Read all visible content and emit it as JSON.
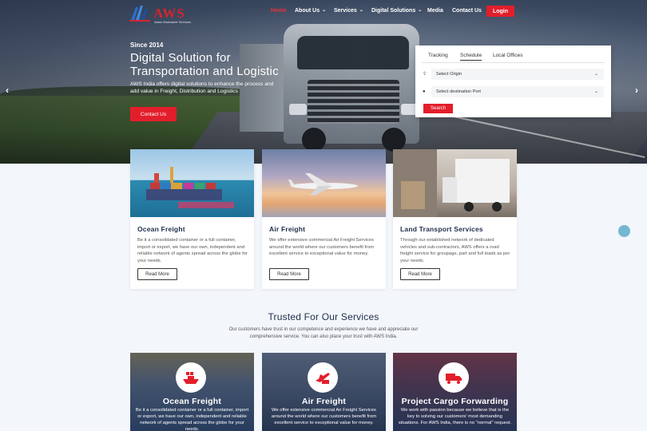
{
  "brand": {
    "logo_text": "AWS",
    "logo_tagline": "Asian Worldwide Services"
  },
  "nav": {
    "items": [
      {
        "label": "Home",
        "has_dropdown": false,
        "active": true
      },
      {
        "label": "About Us",
        "has_dropdown": true
      },
      {
        "label": "Services",
        "has_dropdown": true
      },
      {
        "label": "Digital Solutions",
        "has_dropdown": true
      },
      {
        "label": "Media",
        "has_dropdown": false
      },
      {
        "label": "Contact Us",
        "has_dropdown": false
      }
    ],
    "login_label": "Login"
  },
  "hero": {
    "since": "Since 2014",
    "title_line1": "Digital Solution for",
    "title_line2": "Transportation and Logistic",
    "description": "AWS India offers digital solutions to enhance the process and add value in Freight, Distribution and Logistics",
    "cta_label": "Contact Us",
    "prev_arrow": "‹",
    "next_arrow": "›"
  },
  "tracking_panel": {
    "tabs": [
      {
        "label": "Tracking",
        "active": false
      },
      {
        "label": "Schedule",
        "active": true
      },
      {
        "label": "Local Offices",
        "active": false
      }
    ],
    "origin_placeholder": "Select Origin",
    "destination_placeholder": "Select destination Port",
    "search_label": "Search"
  },
  "services": [
    {
      "title": "Ocean Freight",
      "text": "Be it a consolidated container or a full container, import or export, we have our own, independent and reliable network of agents spread across the globe for your needs.",
      "button": "Read More"
    },
    {
      "title": "Air Freight",
      "text": "We offer extensive commercial Air Freight Services around the world where our customers benefit from excellent service to exceptional value for money.",
      "button": "Read More"
    },
    {
      "title": "Land Transport Services",
      "text": "Through our established network of dedicated vehicles and sub-contractors, AWS offers a road freight service for groupage, part and full loads as per your needs.",
      "button": "Read More"
    }
  ],
  "trusted": {
    "title": "Trusted For Our Services",
    "description": "Our customers have trust in our competence and experience we have and appreciate our comprehensive service. You can also place your trust with AWS India.",
    "cards": [
      {
        "title": "Ocean Freight",
        "text": "Be it a consolidated container or a full container, import or export, we have our own, independent and reliable network of agents spread across the globe for your needs.",
        "icon": "ship-icon"
      },
      {
        "title": "Air Freight",
        "text": "We offer extensive commercial Air Freight Services around the world where our customers benefit from excellent service to exceptional value for money.",
        "icon": "plane-icon"
      },
      {
        "title": "Project Cargo Forwarding",
        "text": "We work with passion because we believe that is the key to solving our customers' most demanding situations. For AWS India, there is no \"normal\" request.",
        "icon": "truck-icon"
      }
    ]
  },
  "colors": {
    "accent": "#e31e2b",
    "heading": "#1f2d4a",
    "chat_bubble": "#73b7d0"
  }
}
